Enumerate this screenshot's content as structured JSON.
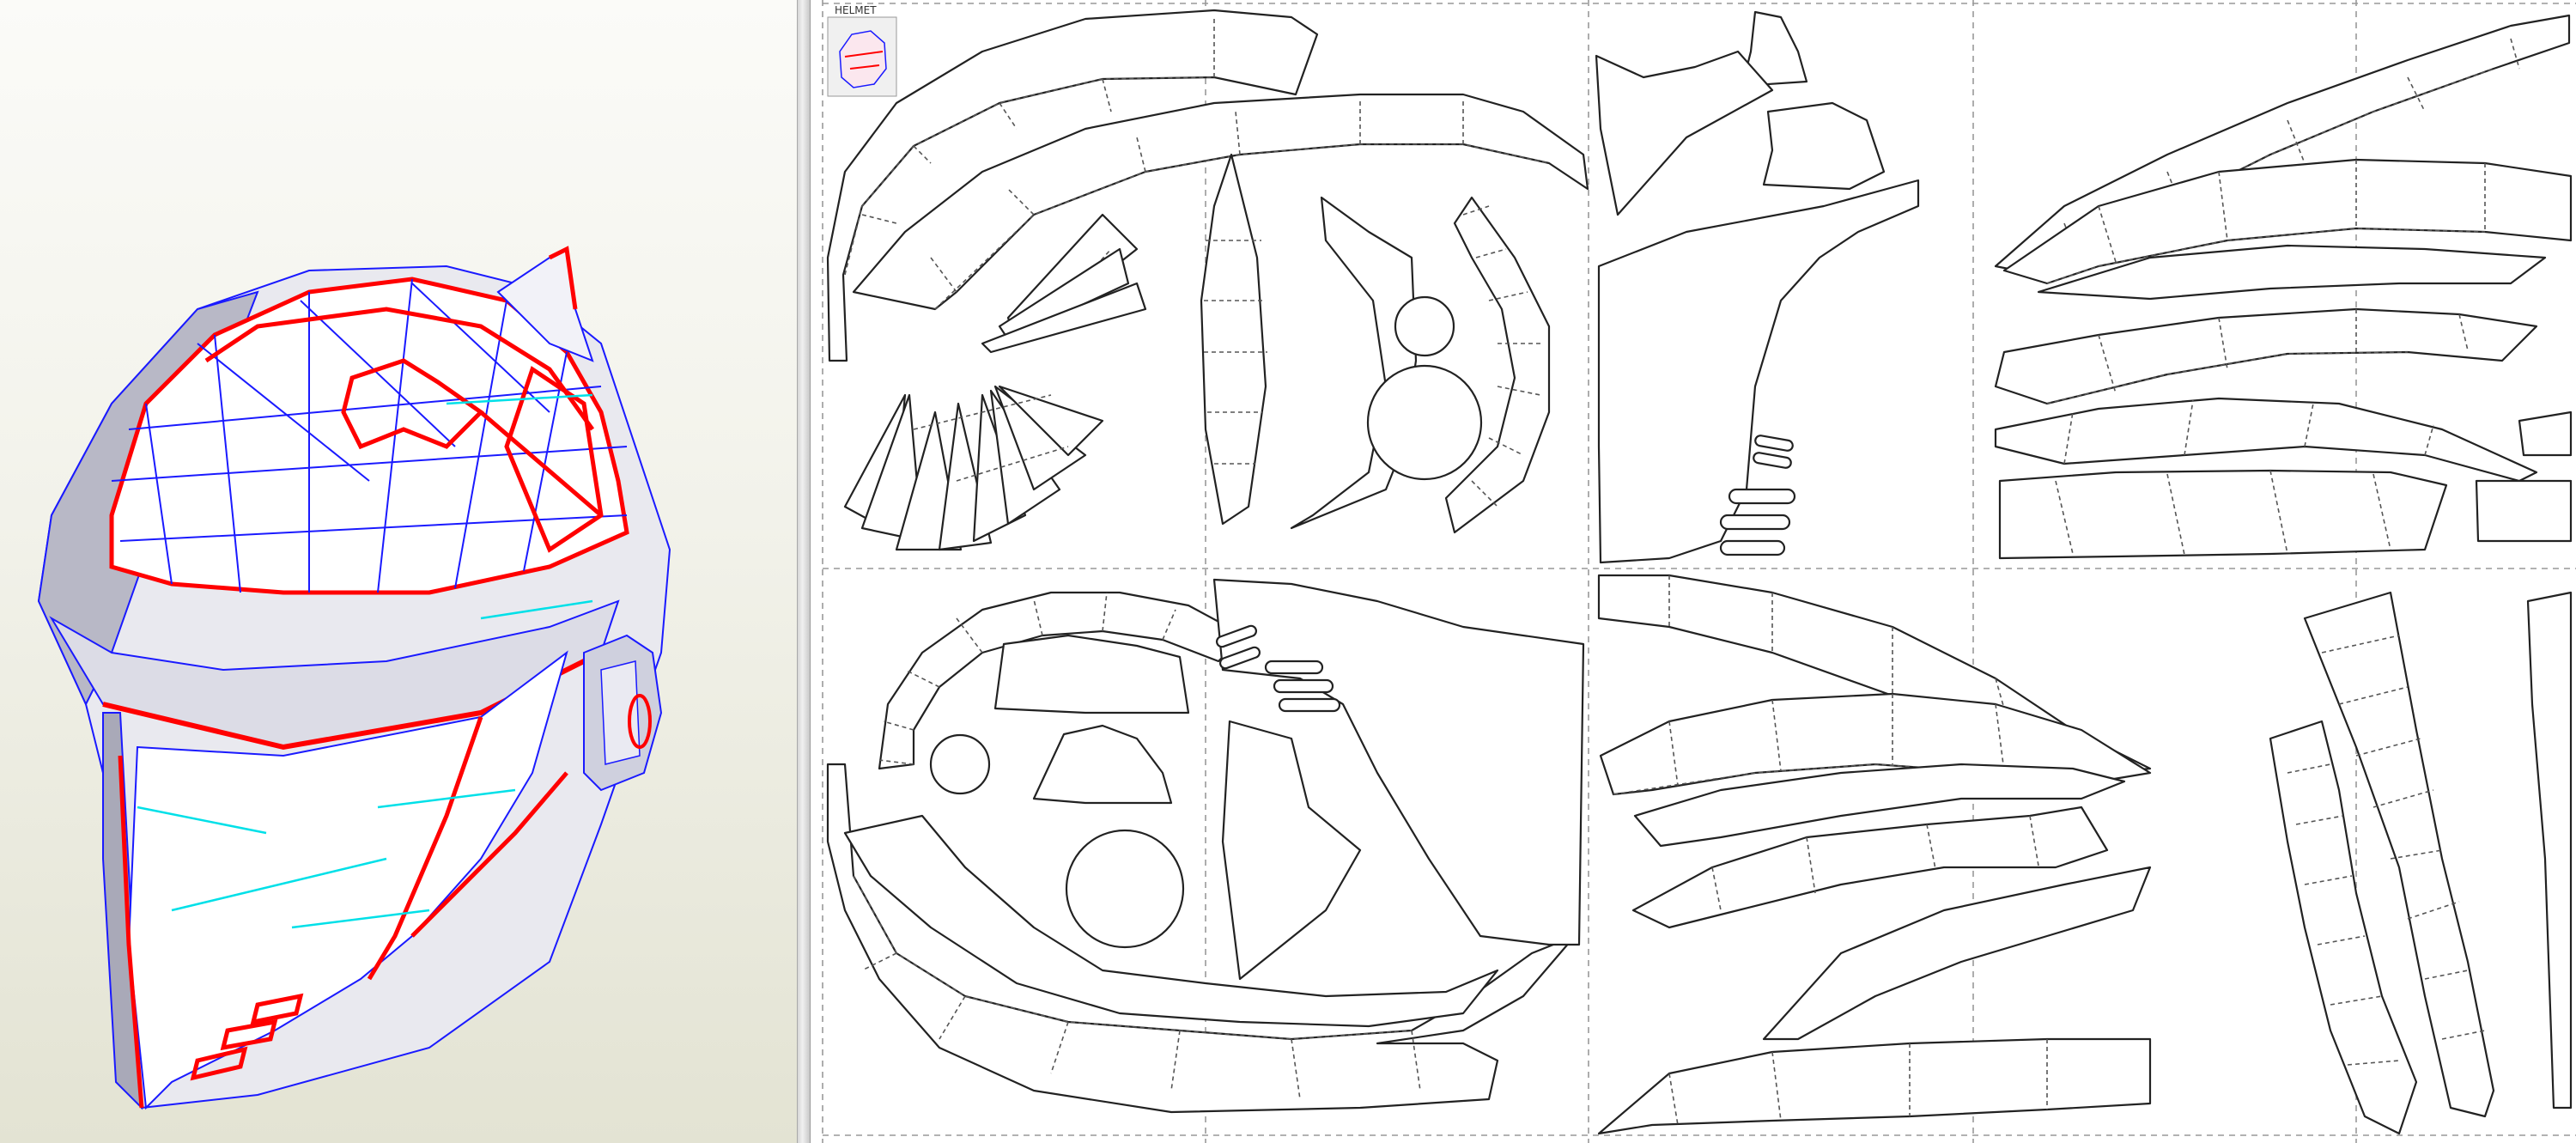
{
  "thumbnail": {
    "label": "HELMET"
  },
  "colors": {
    "mountain_fold": "#ff0000",
    "valley_fold": "#1a1aff",
    "crease": "#00e0e8",
    "part_outline": "#222222",
    "background_3d": "#f2f2ea"
  },
  "icons": [
    "helmet-3d-model",
    "helmet-thumbnail"
  ]
}
